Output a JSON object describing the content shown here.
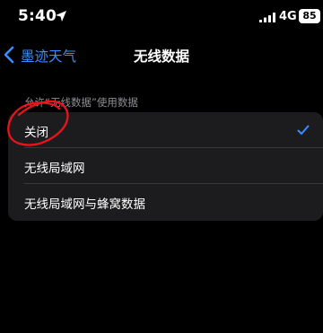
{
  "status_bar": {
    "time": "5:40",
    "network": "4G",
    "battery": "85"
  },
  "nav": {
    "back_label": "墨迹天气",
    "title": "无线数据"
  },
  "section": {
    "header": "允许“无线数据”使用数据"
  },
  "options": [
    {
      "label": "关闭",
      "selected": true
    },
    {
      "label": "无线局域网",
      "selected": false
    },
    {
      "label": "无线局域网与蜂窝数据",
      "selected": false
    }
  ],
  "colors": {
    "accent": "#3a8dfd",
    "card_bg": "#1c1c1e",
    "annotation": "#e8141b"
  }
}
